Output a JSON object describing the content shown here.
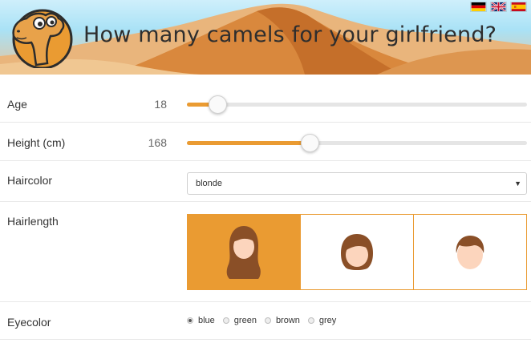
{
  "header": {
    "title": "How many camels for your girlfriend?",
    "logo_icon": "camel-logo-icon",
    "languages": [
      {
        "code": "de",
        "icon": "german-flag-icon"
      },
      {
        "code": "en",
        "icon": "uk-flag-icon"
      },
      {
        "code": "es",
        "icon": "spanish-flag-icon"
      }
    ]
  },
  "form": {
    "age": {
      "label": "Age",
      "value": "18",
      "fraction": 0.09
    },
    "height": {
      "label": "Height (cm)",
      "value": "168",
      "fraction": 0.36
    },
    "haircolor": {
      "label": "Haircolor",
      "selected": "blonde"
    },
    "hairlength": {
      "label": "Hairlength",
      "options": [
        {
          "icon": "long-hair-icon",
          "selected": true
        },
        {
          "icon": "medium-hair-icon",
          "selected": false
        },
        {
          "icon": "short-hair-icon",
          "selected": false
        }
      ]
    },
    "eyecolor": {
      "label": "Eyecolor",
      "options": [
        {
          "label": "blue",
          "checked": true
        },
        {
          "label": "green",
          "checked": false
        },
        {
          "label": "brown",
          "checked": false
        },
        {
          "label": "grey",
          "checked": false
        }
      ]
    }
  },
  "colors": {
    "accent": "#ea9b32",
    "hair": "#8a4f27",
    "skin": "#fcd5bd"
  }
}
